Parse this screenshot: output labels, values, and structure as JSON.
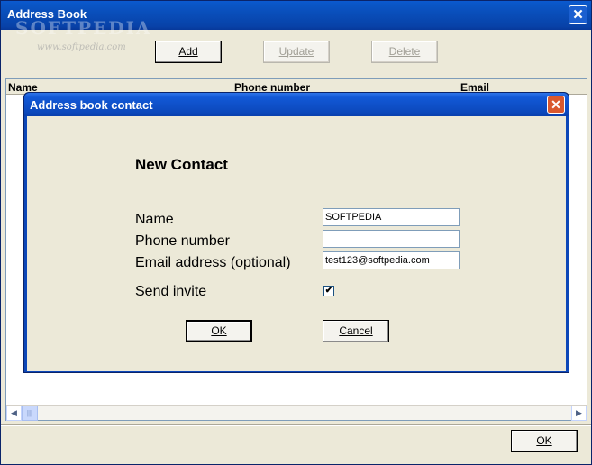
{
  "window": {
    "title": "Address Book",
    "watermark": "SOFTPEDIA",
    "watermark_url": "www.softpedia.com"
  },
  "toolbar": {
    "add_label": "Add",
    "update_label": "Update",
    "delete_label": "Delete"
  },
  "list": {
    "columns": [
      "Name",
      "Phone number",
      "Email"
    ]
  },
  "footer": {
    "ok_label": "OK"
  },
  "dialog": {
    "title": "Address book contact",
    "heading": "New Contact",
    "name_label": "Name",
    "phone_label": "Phone number",
    "email_label": "Email address (optional)",
    "invite_label": "Send invite",
    "name_value": "SOFTPEDIA",
    "phone_value": "",
    "email_value": "test123@softpedia.com",
    "invite_checked": true,
    "check_glyph": "✔",
    "ok_label": "OK",
    "cancel_label": "Cancel"
  },
  "colors": {
    "titlebar": "#0a56c6",
    "dialog_close": "#d9582e",
    "face": "#ece9d8"
  }
}
